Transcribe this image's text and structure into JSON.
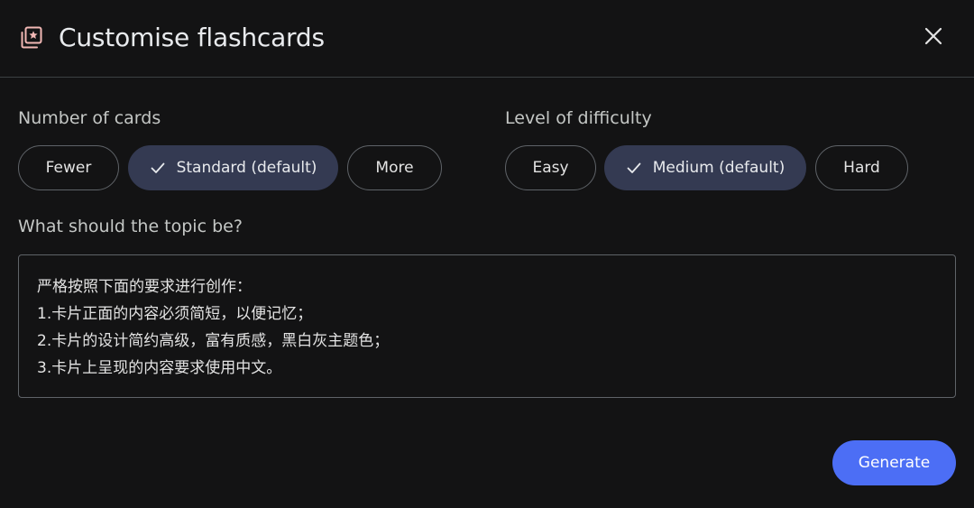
{
  "dialog": {
    "title": "Customise flashcards",
    "icon": "flashcards-icon",
    "close_icon": "close-icon"
  },
  "number_of_cards": {
    "label": "Number of cards",
    "options": [
      {
        "label": "Fewer",
        "selected": false
      },
      {
        "label": "Standard (default)",
        "selected": true
      },
      {
        "label": "More",
        "selected": false
      }
    ]
  },
  "difficulty": {
    "label": "Level of difficulty",
    "options": [
      {
        "label": "Easy",
        "selected": false
      },
      {
        "label": "Medium (default)",
        "selected": true
      },
      {
        "label": "Hard",
        "selected": false
      }
    ]
  },
  "topic": {
    "label": "What should the topic be?",
    "lines": [
      "严格按照下面的要求进行创作：",
      "1.卡片正面的内容必须简短，以便记忆；",
      "2.卡片的设计简约高级，富有质感，黑白灰主题色；",
      "3.卡片上呈现的内容要求使用中文。"
    ]
  },
  "actions": {
    "generate_label": "Generate"
  },
  "colors": {
    "background": "#131314",
    "selected_chip": "#343a52",
    "primary_button": "#4c6ef5",
    "icon_accent": "#f2b8b5"
  }
}
